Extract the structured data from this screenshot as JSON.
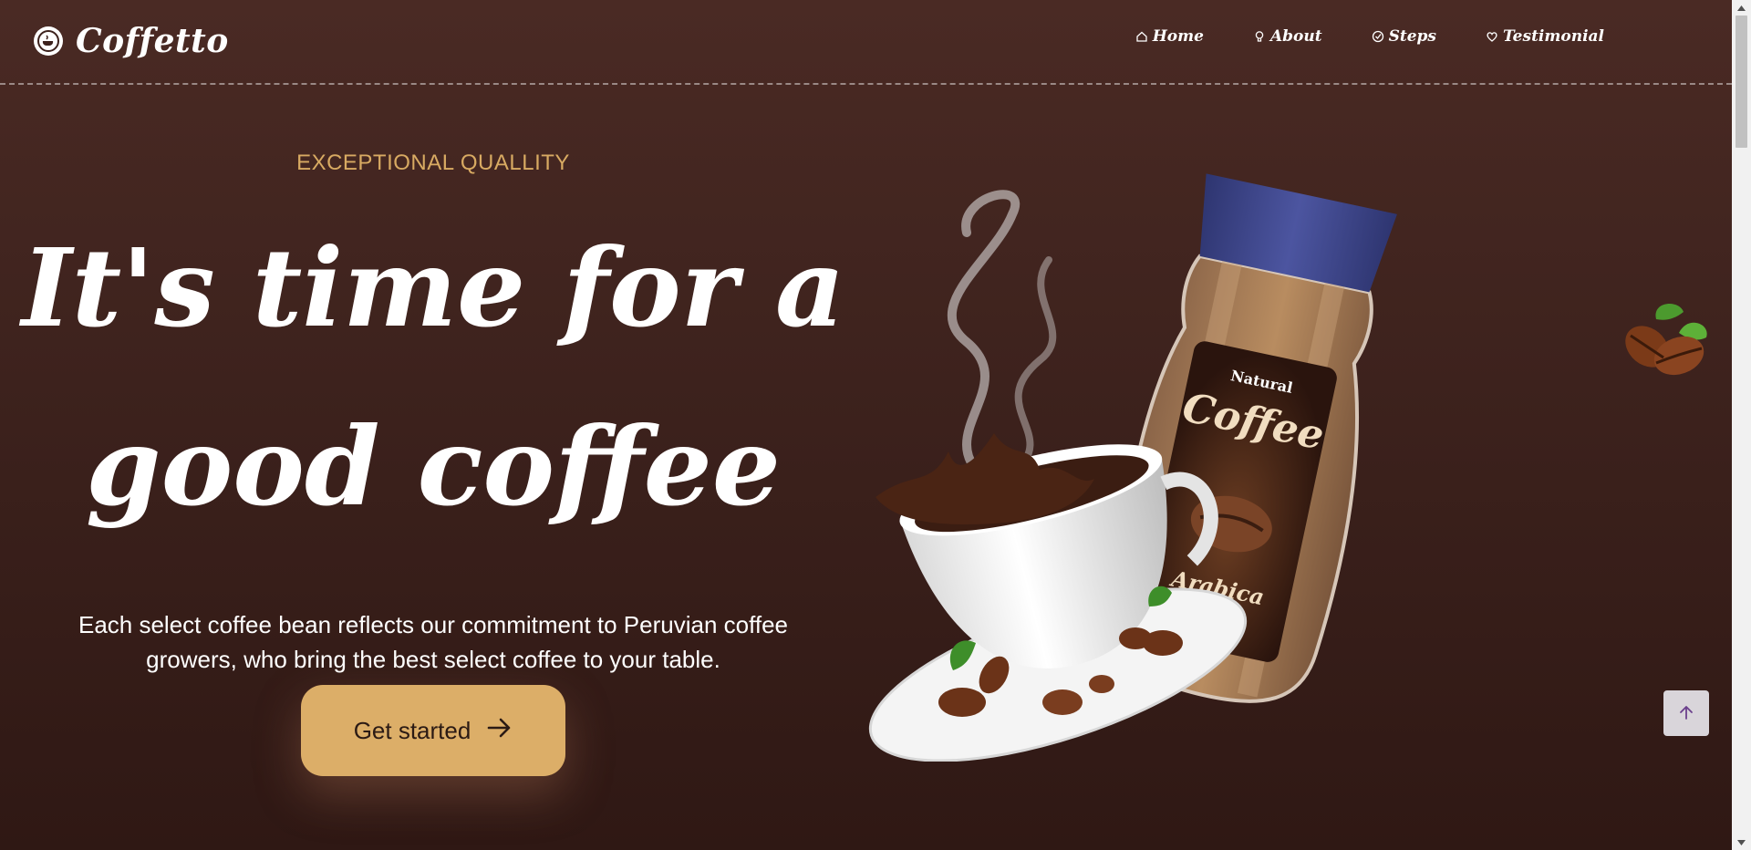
{
  "brand": {
    "name": "Coffetto",
    "logo_icon": "coffee-cup-icon"
  },
  "nav": {
    "items": [
      {
        "label": "Home",
        "icon": "home-icon"
      },
      {
        "label": "About",
        "icon": "lightbulb-icon"
      },
      {
        "label": "Steps",
        "icon": "check-circle-icon"
      },
      {
        "label": "Testimonial",
        "icon": "heart-icon"
      }
    ]
  },
  "hero": {
    "eyebrow": "EXCEPTIONAL QUALLITY",
    "headline_line1": "It's time for a",
    "headline_line2": "good coffee",
    "subtext_line1": "Each select coffee bean reflects our commitment to Peruvian coffee",
    "subtext_line2": "growers, who bring the best select coffee to your table.",
    "cta_label": "Get started",
    "cta_icon": "arrow-right-icon"
  },
  "product": {
    "jar_label_top": "Natural",
    "jar_label_main": "Coffee",
    "jar_label_variety": "Arabica"
  },
  "widgets": {
    "scroll_top_icon": "arrow-up-icon",
    "decoration_icon": "coffee-beans-icon"
  },
  "colors": {
    "background": "#45261f",
    "accent": "#dcae68",
    "jar_lid": "#424a91"
  }
}
